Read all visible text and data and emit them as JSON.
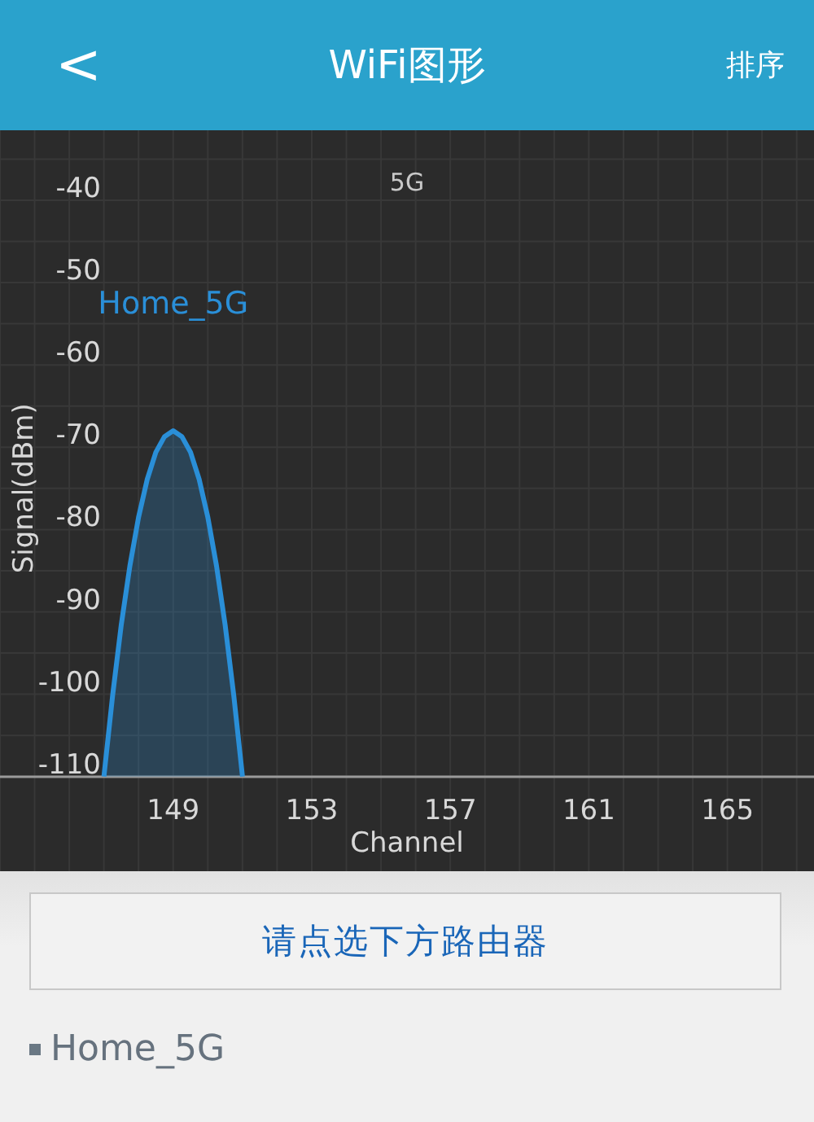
{
  "header": {
    "back": "<",
    "title": "WiFi图形",
    "action": "排序"
  },
  "chart": {
    "chart_data": {
      "type": "line",
      "title": "5G",
      "xlabel": "Channel",
      "ylabel": "Signal(dBm)",
      "xlim": [
        144,
        167.5
      ],
      "ylim": [
        -121.5,
        -31.5
      ],
      "grid": true,
      "xticks": [
        149,
        153,
        157,
        161,
        165
      ],
      "yticks": [
        -40,
        -50,
        -60,
        -70,
        -80,
        -90,
        -100,
        -110
      ],
      "x": [
        147,
        147.25,
        147.5,
        147.75,
        148,
        148.25,
        148.5,
        148.75,
        149,
        149.25,
        149.5,
        149.75,
        150,
        150.25,
        150.5,
        150.75,
        151
      ],
      "series": [
        {
          "name": "Home_5G",
          "color": "#2a8fd8",
          "values": [
            -110,
            -100.2,
            -91.6,
            -84.4,
            -78.5,
            -73.9,
            -70.6,
            -68.7,
            -68,
            -68.7,
            -70.6,
            -73.9,
            -78.5,
            -84.4,
            -91.6,
            -100.2,
            -110
          ]
        }
      ]
    }
  },
  "prompt_button": "请点选下方路由器",
  "routers": [
    {
      "name": "Home_5G"
    }
  ]
}
